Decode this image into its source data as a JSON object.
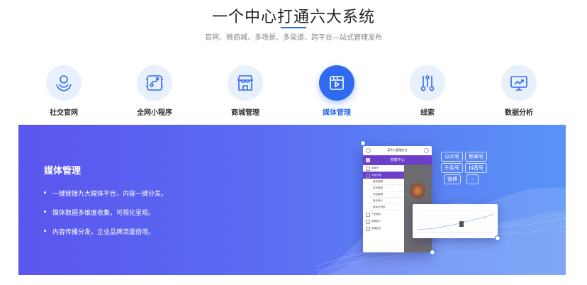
{
  "header": {
    "title": "一个中心打通六大系统",
    "subtitle": "官网、微商城、多场景、多渠道、跨平台—站式管理发布"
  },
  "tabs": [
    {
      "label": "社交官网",
      "icon": "social-website-icon",
      "active": false
    },
    {
      "label": "全网小程序",
      "icon": "mini-program-icon",
      "active": false
    },
    {
      "label": "商城管理",
      "icon": "store-icon",
      "active": false
    },
    {
      "label": "媒体管理",
      "icon": "video-play-icon",
      "active": true
    },
    {
      "label": "线索",
      "icon": "lead-icon",
      "active": false
    },
    {
      "label": "数据分析",
      "icon": "analytics-icon",
      "active": false
    }
  ],
  "colors": {
    "accent": "#2f6bef",
    "icon_bg": "#e8effd",
    "banner_start": "#5a55ee",
    "banner_end": "#5a93f6"
  },
  "panel": {
    "title": "媒体管理",
    "bullets": [
      "一键链接九大媒体平台，内容一键分发。",
      "媒体数据多维度收集，可视化呈现。",
      "内容传播分发，企业品牌流量倍增。"
    ],
    "tags": [
      "公众号",
      "熊掌号",
      "头条号",
      "抖音号",
      "微博",
      "···"
    ],
    "phone": {
      "top_title": "某中心管理后台",
      "header": "管理中心",
      "menu": [
        "媒体号",
        "内容分发",
        "产品展示",
        "营销推广",
        "数据统计"
      ],
      "submenu": [
        "媒体管理",
        "发布管理",
        "内容管理",
        "粉丝统计",
        "媒体号授权"
      ]
    }
  }
}
